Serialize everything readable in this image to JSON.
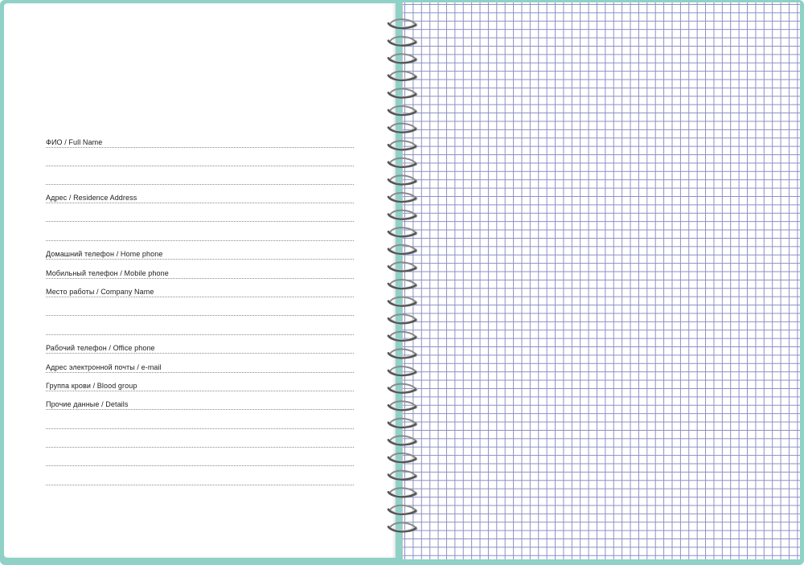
{
  "form": {
    "full_name": "ФИО / Full Name",
    "residence_address": "Адрес / Residence Address",
    "home_phone": "Домашний телефон / Home phone",
    "mobile_phone": "Мобильный телефон / Mobile phone",
    "company_name": "Место работы / Company Name",
    "office_phone": "Рабочий телефон / Office phone",
    "email": "Адрес электронной почты / e-mail",
    "blood_group": "Группа крови / Blood group",
    "details": "Прочие данные / Details"
  },
  "colors": {
    "cover": "#8fd1c6",
    "grid": "#8b8fc4",
    "spiral": "#555555"
  },
  "icons": {
    "binding": "spiral-binding-icon"
  }
}
